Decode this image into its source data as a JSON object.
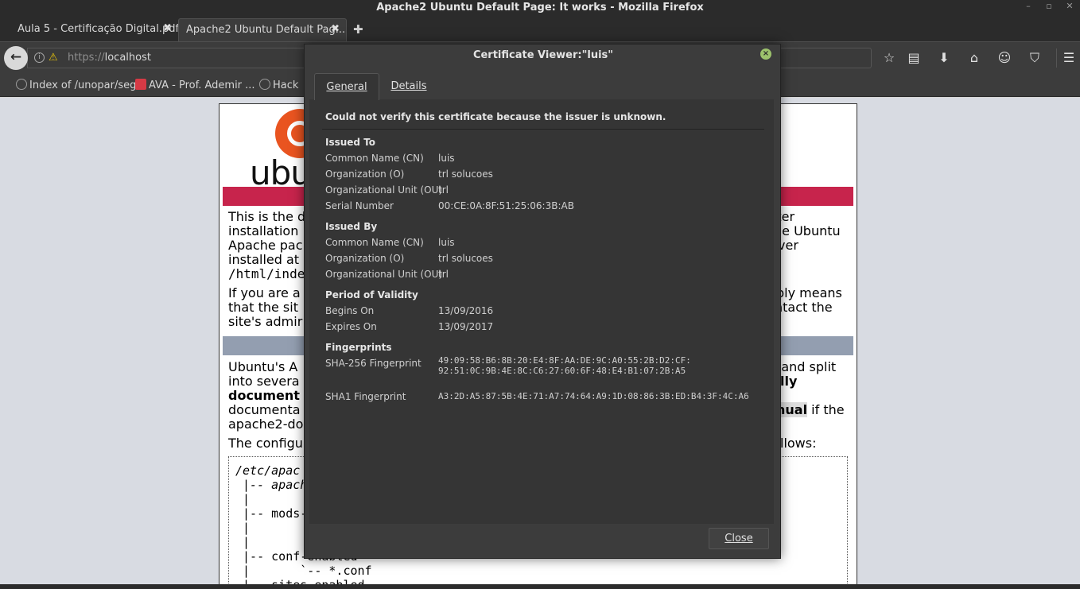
{
  "window": {
    "title": "Apache2 Ubuntu Default Page: It works - Mozilla Firefox"
  },
  "tabs": [
    {
      "label": "Aula 5 - Certificação Digital.pdf"
    },
    {
      "label": "Apache2 Ubuntu Default Pag..."
    }
  ],
  "navbar": {
    "url_scheme": "https://",
    "url_host": "localhost"
  },
  "bookmarks": [
    {
      "label": "Index of /unopar/seg"
    },
    {
      "label": "AVA - Prof. Ademir ..."
    },
    {
      "label": "Hack"
    }
  ],
  "page": {
    "logo_text": "ubun",
    "para1": [
      "This is the d",
      "installation",
      "Apache pac",
      "installed at",
      "/html/inde"
    ],
    "para1_right": [
      "fter",
      "he Ubuntu",
      "ver"
    ],
    "para2": [
      "If you are a",
      "that the sit",
      "site's admir"
    ],
    "para2_right": [
      "bly means",
      "ntact the"
    ],
    "para3": [
      "Ubuntu's A",
      "into severa",
      "document",
      "documenta",
      "apache2-do"
    ],
    "para3_right": [
      "n, and split",
      "lly",
      "nual",
      "if the"
    ],
    "para4": "The configu",
    "para4_right": "llows:",
    "code_lines": [
      "/etc/apac",
      " |-- apach",
      " |",
      " |-- mods-",
      " |       ",
      " |       ",
      " |-- conf-enabled",
      " |       `-- *.conf",
      " |-- sites-enabled"
    ]
  },
  "dialog": {
    "title": "Certificate Viewer:\"luis\"",
    "tabs": {
      "general": "General",
      "details": "Details"
    },
    "warning": "Could not verify this certificate because the issuer is unknown.",
    "issued_to": {
      "heading": "Issued To",
      "cn_label": "Common Name (CN)",
      "cn": "luis",
      "o_label": "Organization (O)",
      "o": "trl solucoes",
      "ou_label": "Organizational Unit (OU)",
      "ou": "trl",
      "serial_label": "Serial Number",
      "serial": "00:CE:0A:8F:51:25:06:3B:AB"
    },
    "issued_by": {
      "heading": "Issued By",
      "cn_label": "Common Name (CN)",
      "cn": "luis",
      "o_label": "Organization (O)",
      "o": "trl solucoes",
      "ou_label": "Organizational Unit (OU)",
      "ou": "trl"
    },
    "validity": {
      "heading": "Period of Validity",
      "begins_label": "Begins On",
      "begins": "13/09/2016",
      "expires_label": "Expires On",
      "expires": "13/09/2017"
    },
    "fingerprints": {
      "heading": "Fingerprints",
      "sha256_label": "SHA-256 Fingerprint",
      "sha256_line1": "49:09:58:B6:8B:20:E4:8F:AA:DE:9C:A0:55:2B:D2:CF:",
      "sha256_line2": "92:51:0C:9B:4E:8C:C6:27:60:6F:48:E4:B1:07:2B:A5",
      "sha1_label": "SHA1 Fingerprint",
      "sha1": "A3:2D:A5:87:5B:4E:71:A7:74:64:A9:1D:08:86:3B:ED:B4:3F:4C:A6"
    },
    "close_label": "Close"
  }
}
